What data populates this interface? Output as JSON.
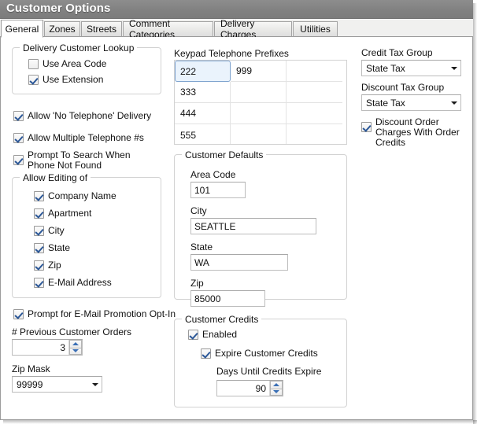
{
  "window": {
    "title": "Customer Options"
  },
  "tabs": [
    {
      "label": "General",
      "active": true
    },
    {
      "label": "Zones",
      "active": false
    },
    {
      "label": "Streets",
      "active": false
    },
    {
      "label": "Comment Categories",
      "active": false
    },
    {
      "label": "Delivery Charges",
      "active": false
    },
    {
      "label": "Utilities",
      "active": false
    }
  ],
  "delivery_customer_lookup": {
    "legend": "Delivery Customer Lookup",
    "use_area_code": {
      "label": "Use Area Code",
      "checked": false
    },
    "use_extension": {
      "label": "Use Extension",
      "checked": true
    }
  },
  "standalone_options": {
    "allow_no_telephone_delivery": {
      "label": "Allow 'No Telephone' Delivery",
      "checked": true
    },
    "allow_multiple_telephones": {
      "label": "Allow Multiple Telephone #s",
      "checked": true
    },
    "prompt_to_search": {
      "label": "Prompt To Search When Phone Not Found",
      "checked": true
    },
    "prompt_email_promotion": {
      "label": "Prompt for E-Mail Promotion Opt-In",
      "checked": true
    }
  },
  "allow_editing_of": {
    "legend": "Allow Editing of",
    "items": [
      {
        "label": "Company Name",
        "checked": true
      },
      {
        "label": "Apartment",
        "checked": true
      },
      {
        "label": "City",
        "checked": true
      },
      {
        "label": "State",
        "checked": true
      },
      {
        "label": "Zip",
        "checked": true
      },
      {
        "label": "E-Mail Address",
        "checked": true
      }
    ]
  },
  "previous_customer_orders": {
    "label": "# Previous Customer Orders",
    "value": "3"
  },
  "zip_mask": {
    "label": "Zip Mask",
    "value": "99999"
  },
  "keypad_prefixes": {
    "label": "Keypad Telephone Prefixes",
    "rows": [
      [
        {
          "value": "222",
          "selected": true
        },
        {
          "value": "999",
          "selected": false
        },
        {
          "value": "",
          "selected": false
        }
      ],
      [
        {
          "value": "333",
          "selected": false
        },
        {
          "value": "",
          "selected": false
        },
        {
          "value": "",
          "selected": false
        }
      ],
      [
        {
          "value": "444",
          "selected": false
        },
        {
          "value": "",
          "selected": false
        },
        {
          "value": "",
          "selected": false
        }
      ],
      [
        {
          "value": "555",
          "selected": false
        },
        {
          "value": "",
          "selected": false
        },
        {
          "value": "",
          "selected": false
        }
      ]
    ]
  },
  "customer_defaults": {
    "legend": "Customer Defaults",
    "area_code": {
      "label": "Area Code",
      "value": "101"
    },
    "city": {
      "label": "City",
      "value": "SEATTLE"
    },
    "state": {
      "label": "State",
      "value": "WA"
    },
    "zip": {
      "label": "Zip",
      "value": "85000"
    }
  },
  "customer_credits": {
    "legend": "Customer Credits",
    "enabled": {
      "label": "Enabled",
      "checked": true
    },
    "expire_credits": {
      "label": "Expire Customer Credits",
      "checked": true
    },
    "days_until": {
      "label": "Days Until Credits Expire",
      "value": "90"
    }
  },
  "tax": {
    "credit_tax_group": {
      "label": "Credit Tax Group",
      "value": "State Tax"
    },
    "discount_tax_group": {
      "label": "Discount Tax Group",
      "value": "State Tax"
    },
    "discount_order_charges": {
      "label": "Discount Order Charges With Order Credits",
      "checked": true
    }
  },
  "colors": {
    "titlebar": "#828282",
    "accent_check": "#2b5797",
    "selected_cell": "#eaf3fc"
  }
}
